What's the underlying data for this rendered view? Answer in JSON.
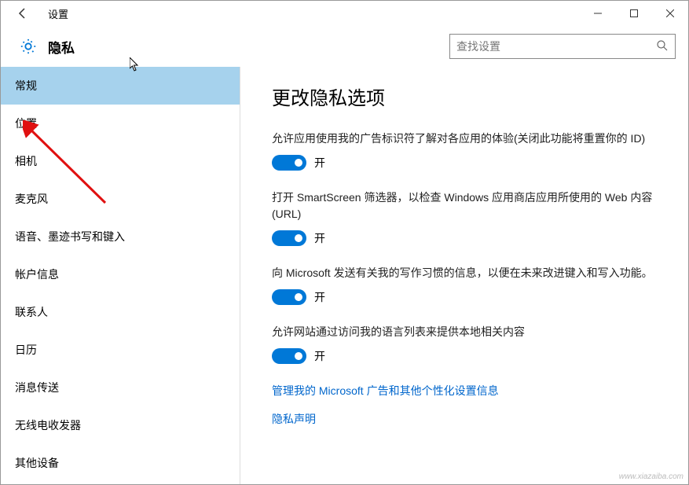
{
  "titlebar": {
    "title": "设置"
  },
  "header": {
    "title": "隐私",
    "search_placeholder": "查找设置"
  },
  "sidebar": {
    "items": [
      {
        "label": "常规",
        "active": true
      },
      {
        "label": "位置"
      },
      {
        "label": "相机"
      },
      {
        "label": "麦克风"
      },
      {
        "label": "语音、墨迹书写和键入"
      },
      {
        "label": "帐户信息"
      },
      {
        "label": "联系人"
      },
      {
        "label": "日历"
      },
      {
        "label": "消息传送"
      },
      {
        "label": "无线电收发器"
      },
      {
        "label": "其他设备"
      }
    ]
  },
  "main": {
    "heading": "更改隐私选项",
    "options": [
      {
        "desc": "允许应用使用我的广告标识符了解对各应用的体验(关闭此功能将重置你的 ID)",
        "state": "开"
      },
      {
        "desc": "打开 SmartScreen 筛选器，以检查 Windows 应用商店应用所使用的 Web 内容(URL)",
        "state": "开"
      },
      {
        "desc": "向 Microsoft 发送有关我的写作习惯的信息，以便在未来改进键入和写入功能。",
        "state": "开"
      },
      {
        "desc": "允许网站通过访问我的语言列表来提供本地相关内容",
        "state": "开"
      }
    ],
    "links": [
      "管理我的 Microsoft 广告和其他个性化设置信息",
      "隐私声明"
    ]
  },
  "watermark": "www.xiazaiba.com"
}
